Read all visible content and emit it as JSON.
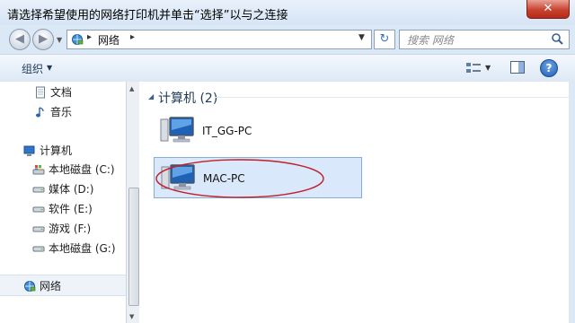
{
  "window": {
    "title": "请选择希望使用的网络打印机并单击“选择”以与之连接",
    "close_label": "✕"
  },
  "address": {
    "path": "网络",
    "search_placeholder": "搜索 网络"
  },
  "toolbar": {
    "organize_label": "组织"
  },
  "navpane": {
    "items": [
      {
        "label": "文档",
        "icon": "documents-icon"
      },
      {
        "label": "音乐",
        "icon": "music-icon"
      },
      {
        "label": "计算机",
        "icon": "computer-icon"
      },
      {
        "label": "本地磁盘 (C:)",
        "icon": "system-drive-icon"
      },
      {
        "label": "媒体 (D:)",
        "icon": "drive-icon"
      },
      {
        "label": "软件 (E:)",
        "icon": "drive-icon"
      },
      {
        "label": "游戏 (F:)",
        "icon": "drive-icon"
      },
      {
        "label": "本地磁盘 (G:)",
        "icon": "drive-icon"
      },
      {
        "label": "网络",
        "icon": "network-icon"
      }
    ]
  },
  "content": {
    "group_title": "计算机 (2)",
    "items": [
      {
        "label": "IT_GG-PC",
        "selected": false
      },
      {
        "label": "MAC-PC",
        "selected": true
      }
    ]
  },
  "colors": {
    "selection_fill": "#d9e8fa",
    "selection_border": "#84acdd",
    "annotation_red": "#c0202a",
    "close_red": "#c7432f"
  }
}
